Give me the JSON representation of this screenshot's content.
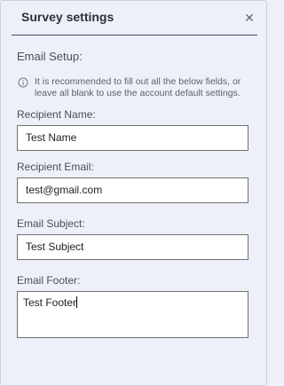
{
  "dialog": {
    "title": "Survey settings",
    "close_icon": "close-icon"
  },
  "section": {
    "label": "Email Setup:"
  },
  "info": {
    "icon": "info-circle-icon",
    "text": "It is recommended to fill out all the below fields, or leave all blank to use the account default settings."
  },
  "fields": {
    "recipient_name": {
      "label": "Recipient Name:",
      "value": "Test Name"
    },
    "recipient_email": {
      "label": "Recipient Email:",
      "value": "test@gmail.com"
    },
    "email_subject": {
      "label": "Email Subject:",
      "value": "Test Subject"
    },
    "email_footer": {
      "label": "Email Footer:",
      "value": "Test Footer"
    }
  }
}
